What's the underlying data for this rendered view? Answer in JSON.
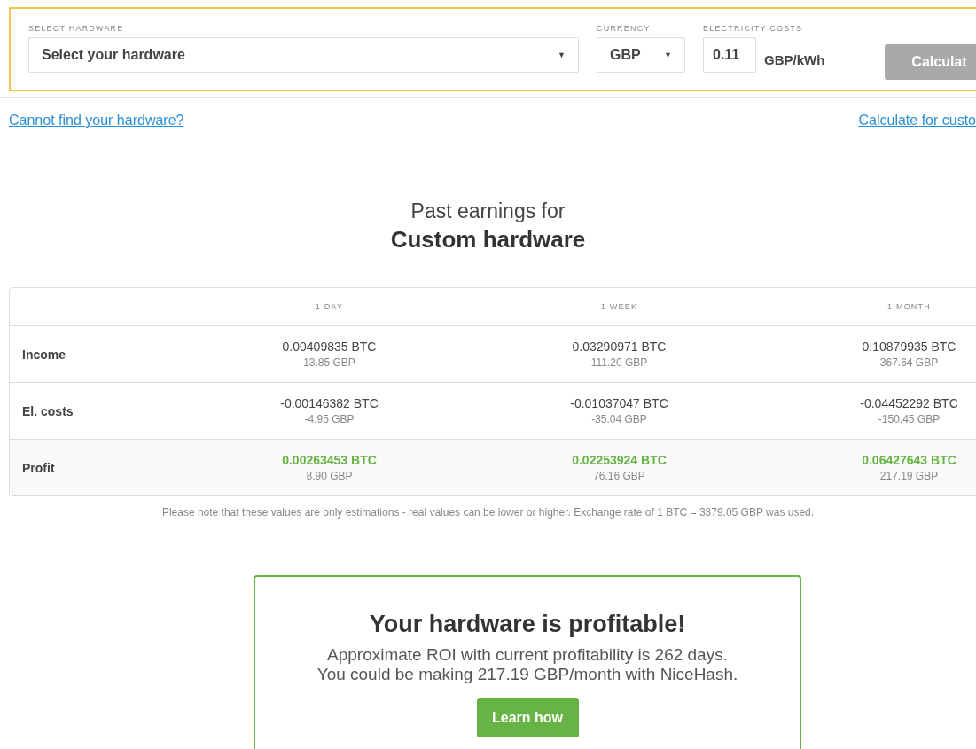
{
  "form": {
    "hardware": {
      "label": "SELECT HARDWARE",
      "value": "Select your hardware",
      "arrow": "▼"
    },
    "currency": {
      "label": "CURRENCY",
      "value": "GBP",
      "arrow": "▼"
    },
    "electricity": {
      "label": "ELECTRICITY COSTS",
      "value": "0.11",
      "unit": "GBP/kWh"
    },
    "calculate_button": {
      "label": "Calculat",
      "disabled": true
    }
  },
  "links": {
    "left": "Cannot find your hardware?",
    "right": "Calculate for custo"
  },
  "heading": {
    "line1": "Past earnings for",
    "line2": "Custom hardware"
  },
  "table": {
    "columns": [
      "1 DAY",
      "1 WEEK",
      "1 MONTH"
    ],
    "rows": [
      {
        "label": "Income",
        "highlight": false,
        "cells": [
          {
            "btc": "0.00409835 BTC",
            "fiat": "13.85 GBP"
          },
          {
            "btc": "0.03290971 BTC",
            "fiat": "111.20 GBP"
          },
          {
            "btc": "0.10879935 BTC",
            "fiat": "367.64 GBP"
          }
        ]
      },
      {
        "label": "El. costs",
        "highlight": false,
        "cells": [
          {
            "btc": "-0.00146382 BTC",
            "fiat": "-4.95 GBP"
          },
          {
            "btc": "-0.01037047 BTC",
            "fiat": "-35.04 GBP"
          },
          {
            "btc": "-0.04452292 BTC",
            "fiat": "-150.45 GBP"
          }
        ]
      },
      {
        "label": "Profit",
        "highlight": true,
        "cells": [
          {
            "btc": "0.00263453 BTC",
            "fiat": "8.90 GBP"
          },
          {
            "btc": "0.02253924 BTC",
            "fiat": "76.16 GBP"
          },
          {
            "btc": "0.06427643 BTC",
            "fiat": "217.19 GBP"
          }
        ]
      }
    ]
  },
  "note": "Please note that these values are only estimations - real values can be lower or higher. Exchange rate of 1 BTC = 3379.05 GBP was used.",
  "result": {
    "title": "Your hardware is profitable!",
    "lines": [
      "Approximate ROI with current profitability is 262 days.",
      "You could be making 217.19 GBP/month with NiceHash."
    ],
    "button": "Learn how"
  }
}
